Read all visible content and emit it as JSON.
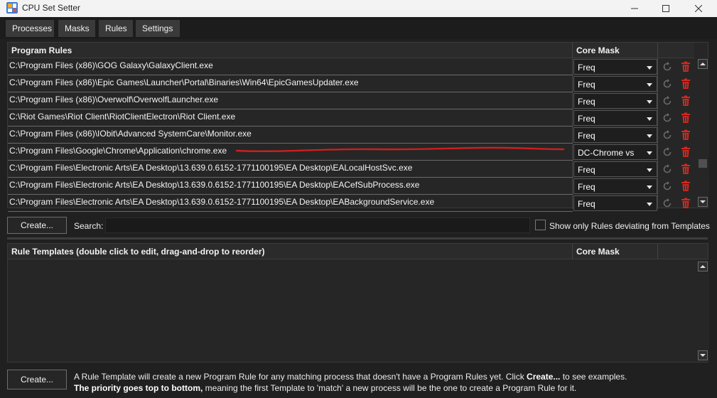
{
  "window": {
    "title": "CPU Set Setter",
    "titlebar_bg": "#f3f3f3"
  },
  "tabs": [
    {
      "label": "Processes"
    },
    {
      "label": "Masks"
    },
    {
      "label": "Rules"
    },
    {
      "label": "Settings"
    }
  ],
  "program_rules": {
    "col_program": "Program Rules",
    "col_mask": "Core Mask",
    "rows": [
      {
        "path": "C:\\Program Files (x86)\\GOG Galaxy\\GalaxyClient.exe",
        "mask": "Freq"
      },
      {
        "path": "C:\\Program Files (x86)\\Epic Games\\Launcher\\Portal\\Binaries\\Win64\\EpicGamesUpdater.exe",
        "mask": "Freq"
      },
      {
        "path": "C:\\Program Files (x86)\\Overwolf\\OverwolfLauncher.exe",
        "mask": "Freq"
      },
      {
        "path": "C:\\Riot Games\\Riot Client\\RiotClientElectron\\Riot Client.exe",
        "mask": "Freq"
      },
      {
        "path": "C:\\Program Files (x86)\\IObit\\Advanced SystemCare\\Monitor.exe",
        "mask": "Freq"
      },
      {
        "path": "C:\\Program Files\\Google\\Chrome\\Application\\chrome.exe",
        "mask": "DC-Chrome vs"
      },
      {
        "path": "C:\\Program Files\\Electronic Arts\\EA Desktop\\13.639.0.6152-1771100195\\EA Desktop\\EALocalHostSvc.exe",
        "mask": "Freq"
      },
      {
        "path": "C:\\Program Files\\Electronic Arts\\EA Desktop\\13.639.0.6152-1771100195\\EA Desktop\\EACefSubProcess.exe",
        "mask": "Freq"
      },
      {
        "path": "C:\\Program Files\\Electronic Arts\\EA Desktop\\13.639.0.6152-1771100195\\EA Desktop\\EABackgroundService.exe",
        "mask": "Freq"
      }
    ]
  },
  "controls": {
    "create_label": "Create...",
    "search_label": "Search:",
    "search_value": "",
    "show_deviating_label": "Show only Rules deviating from Templates"
  },
  "rule_templates": {
    "col_template": "Rule Templates (double click to edit, drag-and-drop to reorder)",
    "col_mask": "Core Mask"
  },
  "footer": {
    "create_label": "Create...",
    "line1_a": "A Rule Template will create a new Program Rule for any matching process that doesn't have a Program Rules yet. Click ",
    "line1_b": "Create...",
    "line1_c": " to see examples.",
    "line2_a": "The priority goes top to bottom,",
    "line2_b": " meaning the first Template to 'match' a new process will be the one to create a Program Rule for it."
  },
  "icons": {
    "refresh": "refresh-icon",
    "delete": "trash-icon",
    "app": "cpu-app-icon"
  },
  "colors": {
    "background": "#202020",
    "delete_red": "#d9261c",
    "annotation_red": "#cc1f1f"
  }
}
